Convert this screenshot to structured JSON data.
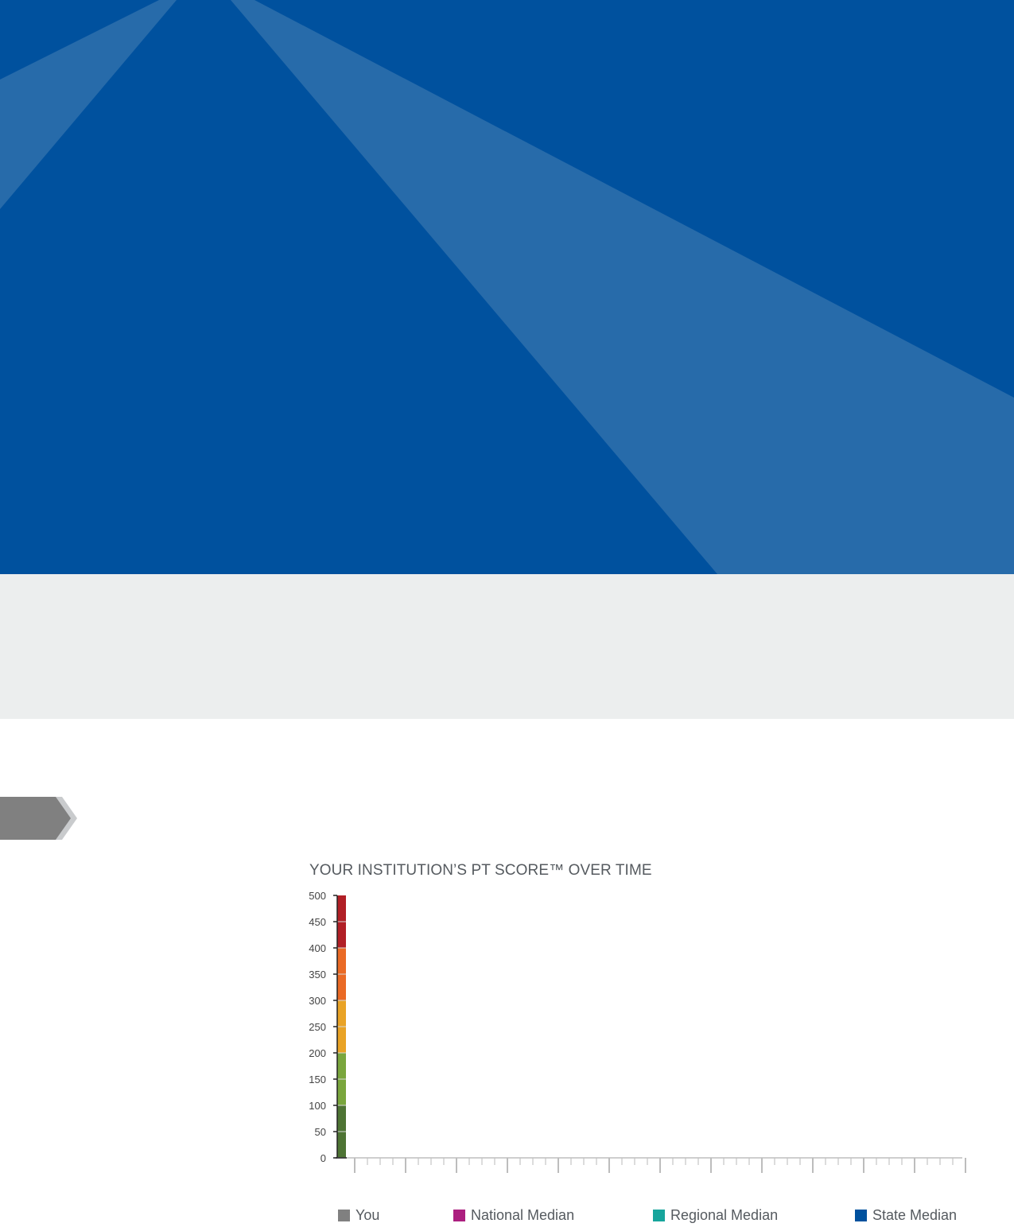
{
  "colors": {
    "hero_bg": "#00519e",
    "hero_beam": "#276baa",
    "band": "#eceeee",
    "tab": "#808080",
    "tab_edge": "#c9cbcd"
  },
  "chart_data": {
    "type": "line",
    "title": "YOUR INSTITUTION’S PT SCORE™ OVER TIME",
    "xlabel": "",
    "ylabel": "",
    "ylim": [
      0,
      500
    ],
    "y_ticks": [
      0,
      50,
      100,
      150,
      200,
      250,
      300,
      350,
      400,
      450,
      500
    ],
    "x_major_ticks": 13,
    "x_minor_per_major": 4,
    "grid": false,
    "legend_position": "bottom",
    "color_scale": [
      {
        "from": 0,
        "to": 100,
        "color": "#4e7434"
      },
      {
        "from": 100,
        "to": 200,
        "color": "#7aa63d"
      },
      {
        "from": 200,
        "to": 300,
        "color": "#e9a326"
      },
      {
        "from": 300,
        "to": 400,
        "color": "#ea6a25"
      },
      {
        "from": 400,
        "to": 500,
        "color": "#b11f26"
      }
    ],
    "series": [
      {
        "name": "You",
        "color": "#808080",
        "values": []
      },
      {
        "name": "National Median",
        "color": "#ac1f7f",
        "values": []
      },
      {
        "name": "Regional Median",
        "color": "#17a59c",
        "values": []
      },
      {
        "name": "State Median",
        "color": "#00519e",
        "values": []
      }
    ]
  }
}
